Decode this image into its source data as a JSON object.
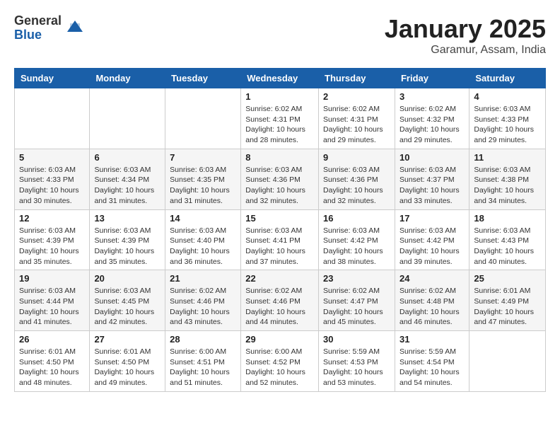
{
  "logo": {
    "general": "General",
    "blue": "Blue"
  },
  "title": "January 2025",
  "subtitle": "Garamur, Assam, India",
  "weekdays": [
    "Sunday",
    "Monday",
    "Tuesday",
    "Wednesday",
    "Thursday",
    "Friday",
    "Saturday"
  ],
  "weeks": [
    [
      {
        "day": "",
        "info": ""
      },
      {
        "day": "",
        "info": ""
      },
      {
        "day": "",
        "info": ""
      },
      {
        "day": "1",
        "info": "Sunrise: 6:02 AM\nSunset: 4:31 PM\nDaylight: 10 hours\nand 28 minutes."
      },
      {
        "day": "2",
        "info": "Sunrise: 6:02 AM\nSunset: 4:31 PM\nDaylight: 10 hours\nand 29 minutes."
      },
      {
        "day": "3",
        "info": "Sunrise: 6:02 AM\nSunset: 4:32 PM\nDaylight: 10 hours\nand 29 minutes."
      },
      {
        "day": "4",
        "info": "Sunrise: 6:03 AM\nSunset: 4:33 PM\nDaylight: 10 hours\nand 29 minutes."
      }
    ],
    [
      {
        "day": "5",
        "info": "Sunrise: 6:03 AM\nSunset: 4:33 PM\nDaylight: 10 hours\nand 30 minutes."
      },
      {
        "day": "6",
        "info": "Sunrise: 6:03 AM\nSunset: 4:34 PM\nDaylight: 10 hours\nand 31 minutes."
      },
      {
        "day": "7",
        "info": "Sunrise: 6:03 AM\nSunset: 4:35 PM\nDaylight: 10 hours\nand 31 minutes."
      },
      {
        "day": "8",
        "info": "Sunrise: 6:03 AM\nSunset: 4:36 PM\nDaylight: 10 hours\nand 32 minutes."
      },
      {
        "day": "9",
        "info": "Sunrise: 6:03 AM\nSunset: 4:36 PM\nDaylight: 10 hours\nand 32 minutes."
      },
      {
        "day": "10",
        "info": "Sunrise: 6:03 AM\nSunset: 4:37 PM\nDaylight: 10 hours\nand 33 minutes."
      },
      {
        "day": "11",
        "info": "Sunrise: 6:03 AM\nSunset: 4:38 PM\nDaylight: 10 hours\nand 34 minutes."
      }
    ],
    [
      {
        "day": "12",
        "info": "Sunrise: 6:03 AM\nSunset: 4:39 PM\nDaylight: 10 hours\nand 35 minutes."
      },
      {
        "day": "13",
        "info": "Sunrise: 6:03 AM\nSunset: 4:39 PM\nDaylight: 10 hours\nand 35 minutes."
      },
      {
        "day": "14",
        "info": "Sunrise: 6:03 AM\nSunset: 4:40 PM\nDaylight: 10 hours\nand 36 minutes."
      },
      {
        "day": "15",
        "info": "Sunrise: 6:03 AM\nSunset: 4:41 PM\nDaylight: 10 hours\nand 37 minutes."
      },
      {
        "day": "16",
        "info": "Sunrise: 6:03 AM\nSunset: 4:42 PM\nDaylight: 10 hours\nand 38 minutes."
      },
      {
        "day": "17",
        "info": "Sunrise: 6:03 AM\nSunset: 4:42 PM\nDaylight: 10 hours\nand 39 minutes."
      },
      {
        "day": "18",
        "info": "Sunrise: 6:03 AM\nSunset: 4:43 PM\nDaylight: 10 hours\nand 40 minutes."
      }
    ],
    [
      {
        "day": "19",
        "info": "Sunrise: 6:03 AM\nSunset: 4:44 PM\nDaylight: 10 hours\nand 41 minutes."
      },
      {
        "day": "20",
        "info": "Sunrise: 6:03 AM\nSunset: 4:45 PM\nDaylight: 10 hours\nand 42 minutes."
      },
      {
        "day": "21",
        "info": "Sunrise: 6:02 AM\nSunset: 4:46 PM\nDaylight: 10 hours\nand 43 minutes."
      },
      {
        "day": "22",
        "info": "Sunrise: 6:02 AM\nSunset: 4:46 PM\nDaylight: 10 hours\nand 44 minutes."
      },
      {
        "day": "23",
        "info": "Sunrise: 6:02 AM\nSunset: 4:47 PM\nDaylight: 10 hours\nand 45 minutes."
      },
      {
        "day": "24",
        "info": "Sunrise: 6:02 AM\nSunset: 4:48 PM\nDaylight: 10 hours\nand 46 minutes."
      },
      {
        "day": "25",
        "info": "Sunrise: 6:01 AM\nSunset: 4:49 PM\nDaylight: 10 hours\nand 47 minutes."
      }
    ],
    [
      {
        "day": "26",
        "info": "Sunrise: 6:01 AM\nSunset: 4:50 PM\nDaylight: 10 hours\nand 48 minutes."
      },
      {
        "day": "27",
        "info": "Sunrise: 6:01 AM\nSunset: 4:50 PM\nDaylight: 10 hours\nand 49 minutes."
      },
      {
        "day": "28",
        "info": "Sunrise: 6:00 AM\nSunset: 4:51 PM\nDaylight: 10 hours\nand 51 minutes."
      },
      {
        "day": "29",
        "info": "Sunrise: 6:00 AM\nSunset: 4:52 PM\nDaylight: 10 hours\nand 52 minutes."
      },
      {
        "day": "30",
        "info": "Sunrise: 5:59 AM\nSunset: 4:53 PM\nDaylight: 10 hours\nand 53 minutes."
      },
      {
        "day": "31",
        "info": "Sunrise: 5:59 AM\nSunset: 4:54 PM\nDaylight: 10 hours\nand 54 minutes."
      },
      {
        "day": "",
        "info": ""
      }
    ]
  ]
}
